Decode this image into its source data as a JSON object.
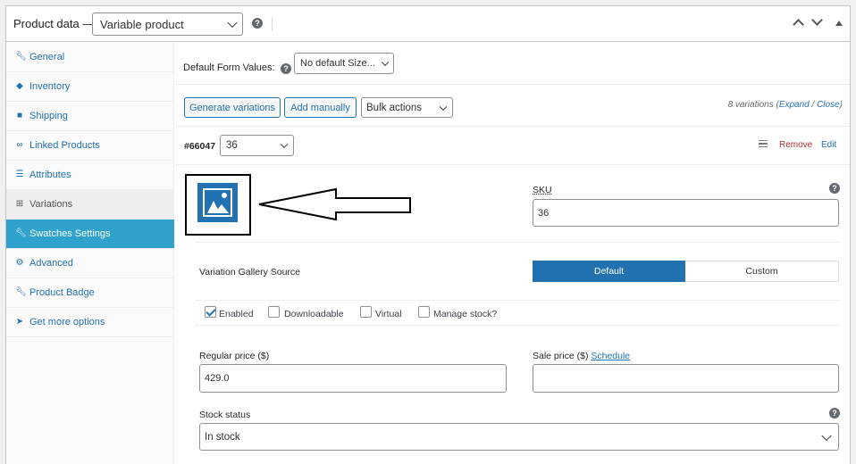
{
  "header": {
    "title": "Product data —",
    "product_type": "Variable product"
  },
  "sidebar": {
    "items": [
      {
        "label": "General",
        "icon": "wrench-icon"
      },
      {
        "label": "Inventory",
        "icon": "tag-icon"
      },
      {
        "label": "Shipping",
        "icon": "truck-icon"
      },
      {
        "label": "Linked Products",
        "icon": "link-icon"
      },
      {
        "label": "Attributes",
        "icon": "list-icon"
      },
      {
        "label": "Variations",
        "icon": "grid-icon"
      },
      {
        "label": "Swatches Settings",
        "icon": "wrench-icon"
      },
      {
        "label": "Advanced",
        "icon": "gear-icon"
      },
      {
        "label": "Product Badge",
        "icon": "wrench-icon"
      },
      {
        "label": "Get more options",
        "icon": "plugin-icon"
      }
    ]
  },
  "defaults": {
    "label": "Default Form Values:",
    "select_value": "No default Size..."
  },
  "toolbar": {
    "generate_label": "Generate variations",
    "add_manually_label": "Add manually",
    "bulk_actions_value": "Bulk actions",
    "count_text": "8 variations (",
    "expand_label": "Expand",
    "slash": " / ",
    "close_label": "Close",
    "close_paren": ")"
  },
  "variation": {
    "id": "#66047",
    "size_value": "36",
    "remove_label": "Remove",
    "edit_label": "Edit",
    "sku_label": "SKU",
    "sku_value": "36",
    "gallery_label": "Variation Gallery Source",
    "gallery_default": "Default",
    "gallery_custom": "Custom",
    "checkboxes": [
      {
        "label": "Enabled",
        "checked": true
      },
      {
        "label": "Downloadable",
        "checked": false
      },
      {
        "label": "Virtual",
        "checked": false
      },
      {
        "label": "Manage stock?",
        "checked": false
      }
    ],
    "regular_price_label": "Regular price ($)",
    "regular_price_value": "429.0",
    "sale_price_label": "Sale price ($) ",
    "schedule_label": "Schedule",
    "sale_price_value": "",
    "stock_status_label": "Stock status",
    "stock_status_value": "In stock"
  },
  "colors": {
    "accent": "#2271b1",
    "active_tab": "#2ea2cc",
    "remove": "#b32d2e"
  }
}
